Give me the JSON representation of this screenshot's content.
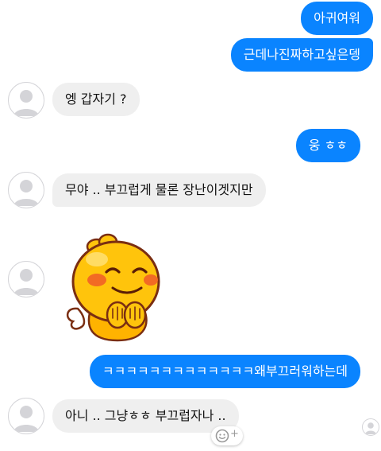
{
  "messages": [
    {
      "direction": "out",
      "text": "아귀여워"
    },
    {
      "direction": "out",
      "text": "근데나진짜하고싶은뎅"
    },
    {
      "direction": "in",
      "text": "엥 갑자기 ?"
    },
    {
      "direction": "out",
      "text": "웅 ㅎㅎ"
    },
    {
      "direction": "in",
      "text": "무야 ..  부끄럽게 물론 장난이겟지만"
    },
    {
      "direction": "in",
      "sticker": "blushing-dragon-sticker"
    },
    {
      "direction": "out",
      "text": "ㅋㅋㅋㅋㅋㅋㅋㅋㅋㅋㅋㅋㅋ왜부끄러워하는데"
    },
    {
      "direction": "in",
      "text": "아니 .. 그냥ㅎㅎ 부끄럽자나 .."
    }
  ],
  "reaction": {
    "icon": "smiley-add-icon",
    "plus": "+"
  },
  "colors": {
    "outgoing": "#0a84ff",
    "incoming": "#efefef"
  }
}
